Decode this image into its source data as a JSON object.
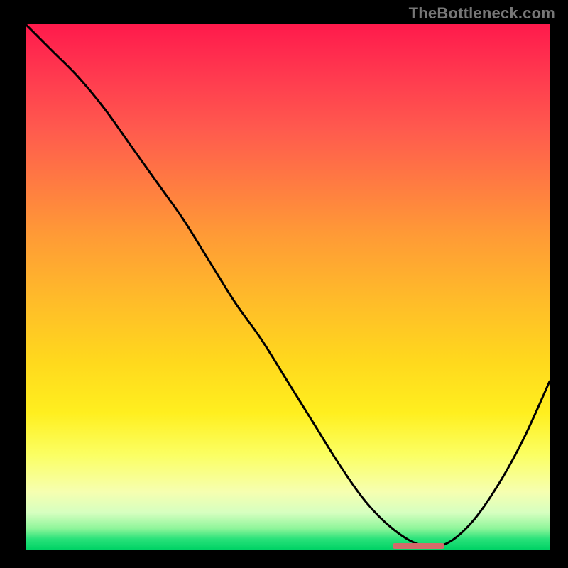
{
  "watermark": "TheBottleneck.com",
  "chart_data": {
    "type": "line",
    "title": "",
    "xlabel": "",
    "ylabel": "",
    "xlim": [
      0,
      100
    ],
    "ylim": [
      0,
      100
    ],
    "x": [
      0,
      5,
      10,
      15,
      20,
      25,
      30,
      35,
      40,
      45,
      50,
      55,
      60,
      65,
      70,
      75,
      80,
      85,
      90,
      95,
      100
    ],
    "values": [
      100,
      95,
      90,
      84,
      77,
      70,
      63,
      55,
      47,
      40,
      32,
      24,
      16,
      9,
      4,
      1,
      1,
      5,
      12,
      21,
      32
    ],
    "minimum_marker": {
      "x_start": 70,
      "x_end": 80,
      "y": 0
    }
  },
  "colors": {
    "curve": "#000000",
    "marker": "#d46a6a",
    "gradient_top": "#ff1744",
    "gradient_bottom": "#00d265",
    "page_bg": "#000000",
    "watermark": "#777777"
  }
}
